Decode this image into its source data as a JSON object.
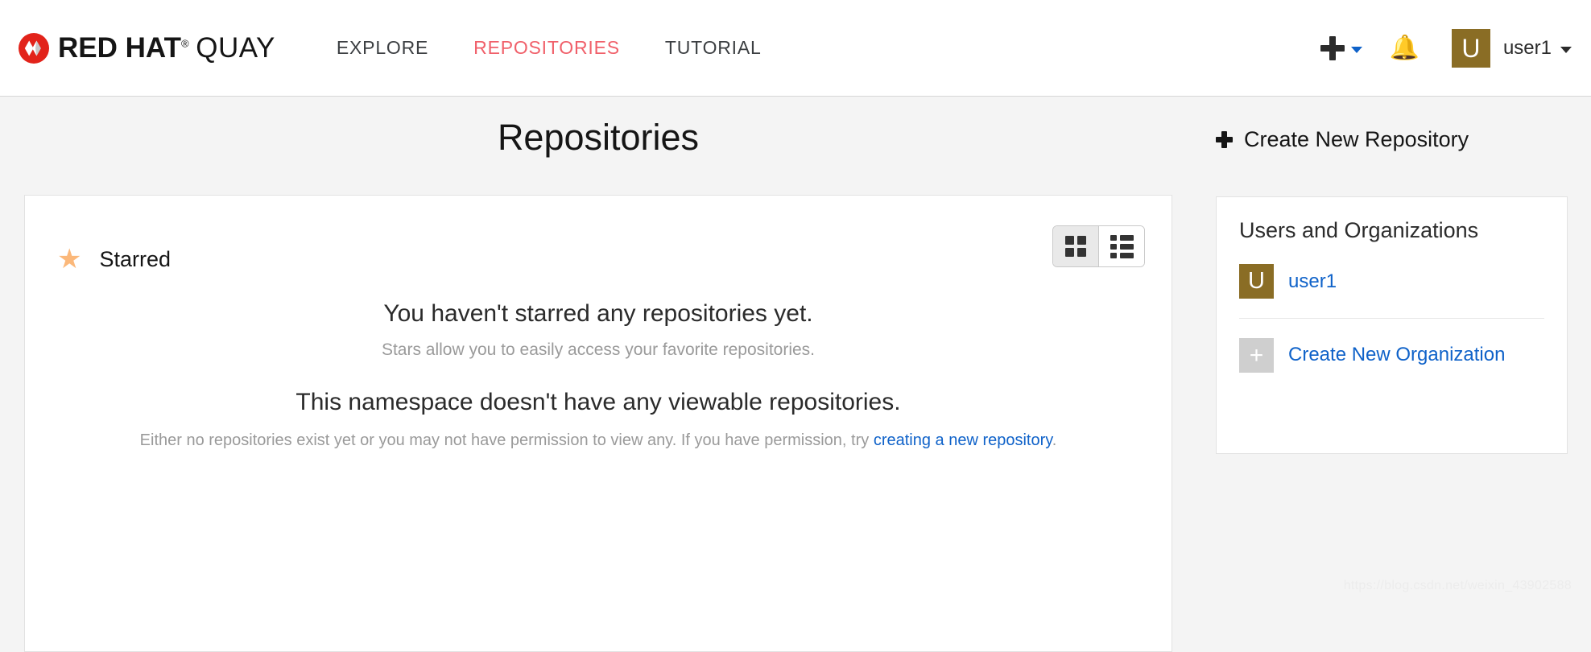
{
  "header": {
    "brand": {
      "red": "RED HAT",
      "registered": "®",
      "product": "QUAY"
    },
    "nav": [
      {
        "label": "EXPLORE",
        "active": false
      },
      {
        "label": "REPOSITORIES",
        "active": true
      },
      {
        "label": "TUTORIAL",
        "active": false
      }
    ],
    "plus_icon": "plus-icon",
    "plus_caret": "chevron-down-icon",
    "bell_icon": "🔔",
    "avatar_initial": "U",
    "user_name": "user1",
    "user_caret": "chevron-down-icon"
  },
  "page": {
    "title": "Repositories",
    "create_repository": {
      "label": "Create New Repository",
      "icon": "plus-icon"
    }
  },
  "main": {
    "starred": {
      "icon": "star-icon",
      "label": "Starred"
    },
    "view_toggle": {
      "grid": "grid-view-icon",
      "list": "list-view-icon",
      "active": "grid"
    },
    "empty_starred": {
      "heading": "You haven't starred any repositories yet.",
      "subtext": "Stars allow you to easily access your favorite repositories."
    },
    "empty_namespace": {
      "heading": "This namespace doesn't have any viewable repositories.",
      "subtext_before": "Either no repositories exist yet or you may not have permission to view any. If you have permission, try ",
      "link": "creating a new repository",
      "subtext_after": "."
    }
  },
  "sidebar": {
    "title": "Users and Organizations",
    "user": {
      "avatar_initial": "U",
      "name": "user1"
    },
    "create_organization": {
      "avatar_glyph": "+",
      "label": "Create New Organization"
    }
  },
  "watermark": "https://blog.csdn.net/weixin_43902588",
  "colors": {
    "accent_red": "#f0606a",
    "link_blue": "#0f62c9",
    "avatar_gold": "#8a6d25",
    "star_orange": "#fbb87a",
    "page_bg": "#f4f4f4"
  }
}
